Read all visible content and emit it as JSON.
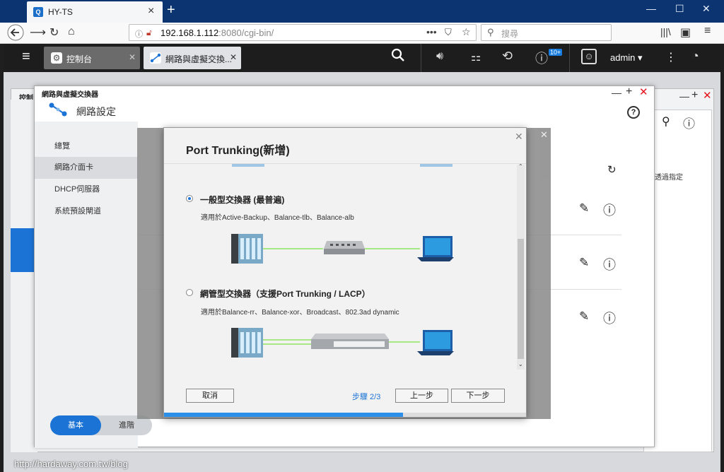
{
  "browser": {
    "tab_title": "HY-TS",
    "url_host": "192.168.1.112",
    "url_rest": ":8080/cgi-bin/",
    "search_placeholder": "搜尋"
  },
  "qts": {
    "tabs": [
      {
        "label": "控制台"
      },
      {
        "label": "網路與虛擬交換..."
      }
    ],
    "notif_count": "10+",
    "user": "admin"
  },
  "bg_window": {
    "title": "控制台",
    "right_text": "透過指定"
  },
  "net_window": {
    "title": "網路與虛擬交換器",
    "header": "網路設定",
    "sidebar": [
      {
        "label": "總覽"
      },
      {
        "label": "網路介面卡"
      },
      {
        "label": "DHCP伺服器"
      },
      {
        "label": "系統預設閘道"
      }
    ],
    "toggle": {
      "basic": "基本",
      "advanced": "進階"
    }
  },
  "dialog": {
    "title": "Port Trunking(新增)",
    "options": [
      {
        "title": "一般型交換器 (最普遍)",
        "desc": "適用於Active-Backup、Balance-tlb、Balance-alb",
        "selected": true
      },
      {
        "title": "網管型交換器（支援Port Trunking / LACP）",
        "desc": "適用於Balance-rr、Balance-xor、Broadcast、802.3ad dynamic",
        "selected": false
      }
    ],
    "cancel": "取消",
    "step": "步驟 2/3",
    "prev": "上一步",
    "next": "下一步",
    "progress": 0.66
  },
  "watermark": "http://hardaway.com.tw/blog",
  "colors": {
    "accent": "#1c73d6",
    "titlebar": "#0b3470",
    "close_red": "#e5141b"
  }
}
